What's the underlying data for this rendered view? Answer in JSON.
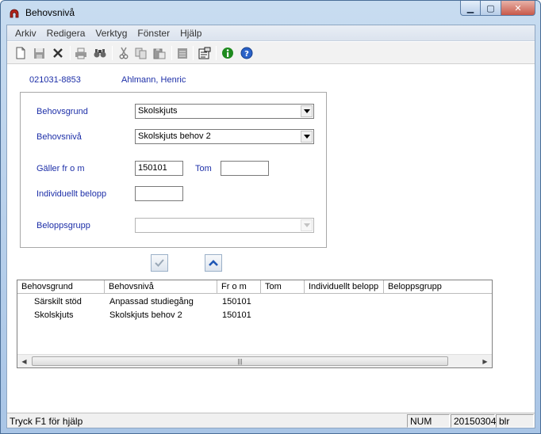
{
  "window": {
    "title": "Behovsnivå"
  },
  "menu": [
    "Arkiv",
    "Redigera",
    "Verktyg",
    "Fönster",
    "Hjälp"
  ],
  "toolbar": [
    "new-icon",
    "save-icon",
    "delete-icon",
    "print-icon",
    "find-icon",
    "cut-icon",
    "copy-icon",
    "paste-icon",
    "notes-icon",
    "properties-icon",
    "info-icon",
    "help-icon"
  ],
  "person": {
    "id": "021031-8853",
    "name": "Ahlmann, Henric"
  },
  "form": {
    "behovsgrund_label": "Behovsgrund",
    "behovsgrund_value": "Skolskjuts",
    "behovsniva_label": "Behovsnivå",
    "behovsniva_value": "Skolskjuts behov 2",
    "galler_from_label": "Gäller fr o m",
    "galler_from_value": "150101",
    "tom_label": "Tom",
    "tom_value": "",
    "belopp_label": "Individuellt belopp",
    "belopp_value": "",
    "beloppsgrupp_label": "Beloppsgrupp",
    "beloppsgrupp_value": ""
  },
  "grid": {
    "columns": [
      "Behovsgrund",
      "Behovsnivå",
      "Fr o m",
      "Tom",
      "Individuellt belopp",
      "Beloppsgrupp"
    ],
    "rows": [
      [
        "Särskilt stöd",
        "Anpassad studiegång",
        "150101",
        "",
        "",
        ""
      ],
      [
        "Skolskjuts",
        "Skolskjuts behov 2",
        "150101",
        "",
        "",
        ""
      ]
    ]
  },
  "status": {
    "help": "Tryck F1 för hjälp",
    "num": "NUM",
    "date": "20150304",
    "user": "blr"
  }
}
